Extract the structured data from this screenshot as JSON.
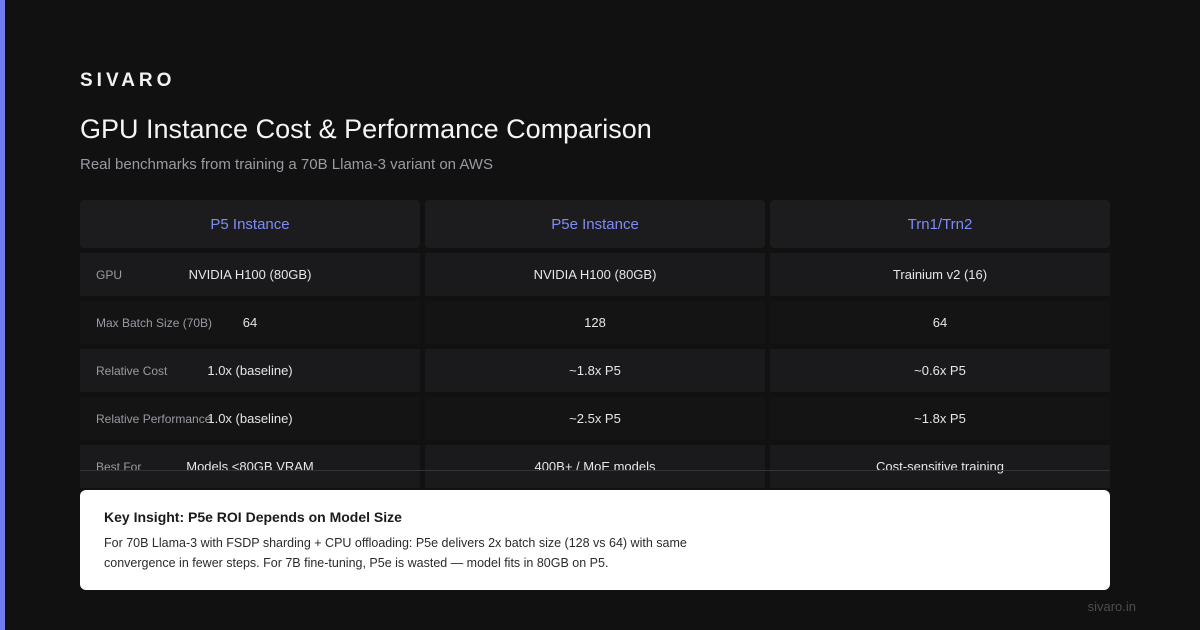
{
  "brand": "SIVARO",
  "title": "GPU Instance Cost & Performance Comparison",
  "subtitle": "Real benchmarks from training a 70B Llama-3 variant on AWS",
  "table": {
    "columns": [
      "P5 Instance",
      "P5e Instance",
      "Trn1/Trn2"
    ],
    "rows": [
      {
        "label": "GPU",
        "values": [
          "NVIDIA H100 (80GB)",
          "NVIDIA H100 (80GB)",
          "Trainium v2 (16)"
        ]
      },
      {
        "label": "Max Batch Size (70B)",
        "values": [
          "64",
          "128",
          "64"
        ]
      },
      {
        "label": "Relative Cost",
        "values": [
          "1.0x (baseline)",
          "~1.8x P5",
          "~0.6x P5"
        ]
      },
      {
        "label": "Relative Performance",
        "values": [
          "1.0x (baseline)",
          "~2.5x P5",
          "~1.8x P5"
        ]
      },
      {
        "label": "Best For",
        "values": [
          "Models <80GB VRAM",
          "400B+ / MoE models",
          "Cost-sensitive training"
        ]
      }
    ]
  },
  "insight": {
    "title": "Key Insight: P5e ROI Depends on Model Size",
    "body": "For 70B Llama-3 with FSDP sharding + CPU offloading: P5e delivers 2x batch size (128 vs 64) with same convergence in fewer steps. For 7B fine-tuning, P5e is wasted — model fits in 80GB on P5."
  },
  "footer": "sivaro.in",
  "colors": {
    "accent": "#6f7df0",
    "background": "#111112",
    "header_text": "#7f8cf3"
  }
}
